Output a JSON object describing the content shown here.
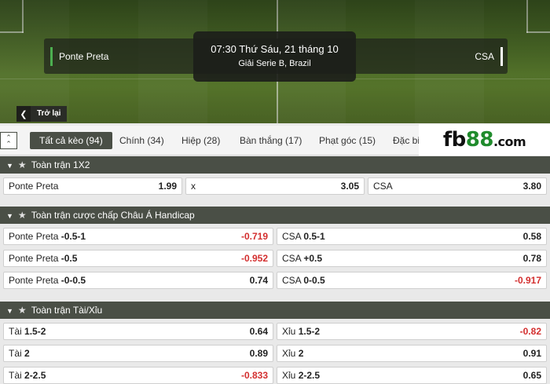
{
  "match": {
    "home_team": "Ponte Preta",
    "away_team": "CSA",
    "time": "07:30 Thứ Sáu, 21 tháng 10",
    "league": "Giải Serie B, Brazil",
    "back_label": "Trở lại"
  },
  "tabs": [
    {
      "label": "Tất cả kèo (94)",
      "active": true
    },
    {
      "label": "Chính (34)"
    },
    {
      "label": "Hiệp (28)"
    },
    {
      "label": "Bàn thắng (17)"
    },
    {
      "label": "Phạt góc (15)"
    },
    {
      "label": "Đặc biệ"
    }
  ],
  "logo": {
    "brand": "fb",
    "num": "88",
    "suffix": ".com"
  },
  "sections": {
    "s1x2": {
      "title": "Toàn trận 1X2",
      "cells": [
        {
          "team": "Ponte Preta",
          "line": "",
          "odd": "1.99"
        },
        {
          "team": "x",
          "line": "",
          "odd": "3.05"
        },
        {
          "team": "CSA",
          "line": "",
          "odd": "3.80"
        }
      ]
    },
    "handicap": {
      "title": "Toàn trận cược chấp Châu Á Handicap",
      "rows": [
        [
          {
            "team": "Ponte Preta",
            "line": "-0.5-1",
            "odd": "-0.719"
          },
          {
            "team": "CSA",
            "line": "0.5-1",
            "odd": "0.58"
          }
        ],
        [
          {
            "team": "Ponte Preta",
            "line": "-0.5",
            "odd": "-0.952"
          },
          {
            "team": "CSA",
            "line": "+0.5",
            "odd": "0.78"
          }
        ],
        [
          {
            "team": "Ponte Preta",
            "line": "-0-0.5",
            "odd": "0.74"
          },
          {
            "team": "CSA",
            "line": "0-0.5",
            "odd": "-0.917"
          }
        ]
      ]
    },
    "overunder": {
      "title": "Toàn trận Tài/Xỉu",
      "rows": [
        [
          {
            "team": "Tài",
            "line": "1.5-2",
            "odd": "0.64"
          },
          {
            "team": "Xỉu",
            "line": "1.5-2",
            "odd": "-0.82"
          }
        ],
        [
          {
            "team": "Tài",
            "line": "2",
            "odd": "0.89"
          },
          {
            "team": "Xỉu",
            "line": "2",
            "odd": "0.91"
          }
        ],
        [
          {
            "team": "Tài",
            "line": "2-2.5",
            "odd": "-0.833"
          },
          {
            "team": "Xỉu",
            "line": "2-2.5",
            "odd": "0.65"
          }
        ]
      ]
    }
  },
  "colors": {
    "header_bg": "#4a4f46",
    "negative": "#d32f2f",
    "accent_green": "#1f8b2c"
  }
}
